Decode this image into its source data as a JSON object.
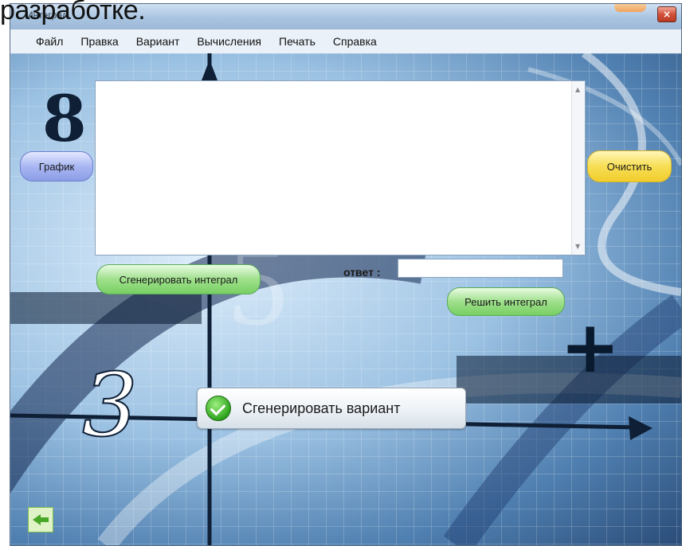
{
  "overlay": {
    "text": "разработке."
  },
  "window": {
    "title": "Интеграл",
    "close_glyph": "×"
  },
  "menu": [
    "Файл",
    "Правка",
    "Вариант",
    "Вычисления",
    "Печать",
    "Справка"
  ],
  "buttons": {
    "graph": "График",
    "clear": "Очистить",
    "generate_integral": "Сгенерировать интеграл",
    "solve_integral": "Решить интеграл",
    "generate_variant": "Сгенерировать вариант"
  },
  "answer": {
    "label": "ответ :",
    "value": ""
  },
  "icons": [
    "check-icon",
    "back-arrow-icon",
    "close-icon",
    "scroll-up-icon",
    "scroll-down-icon"
  ],
  "colors": {
    "graph_button": "#a9b7f2",
    "clear_button": "#f7de55",
    "green_button": "#9fe08c",
    "close_button": "#d3503a"
  }
}
